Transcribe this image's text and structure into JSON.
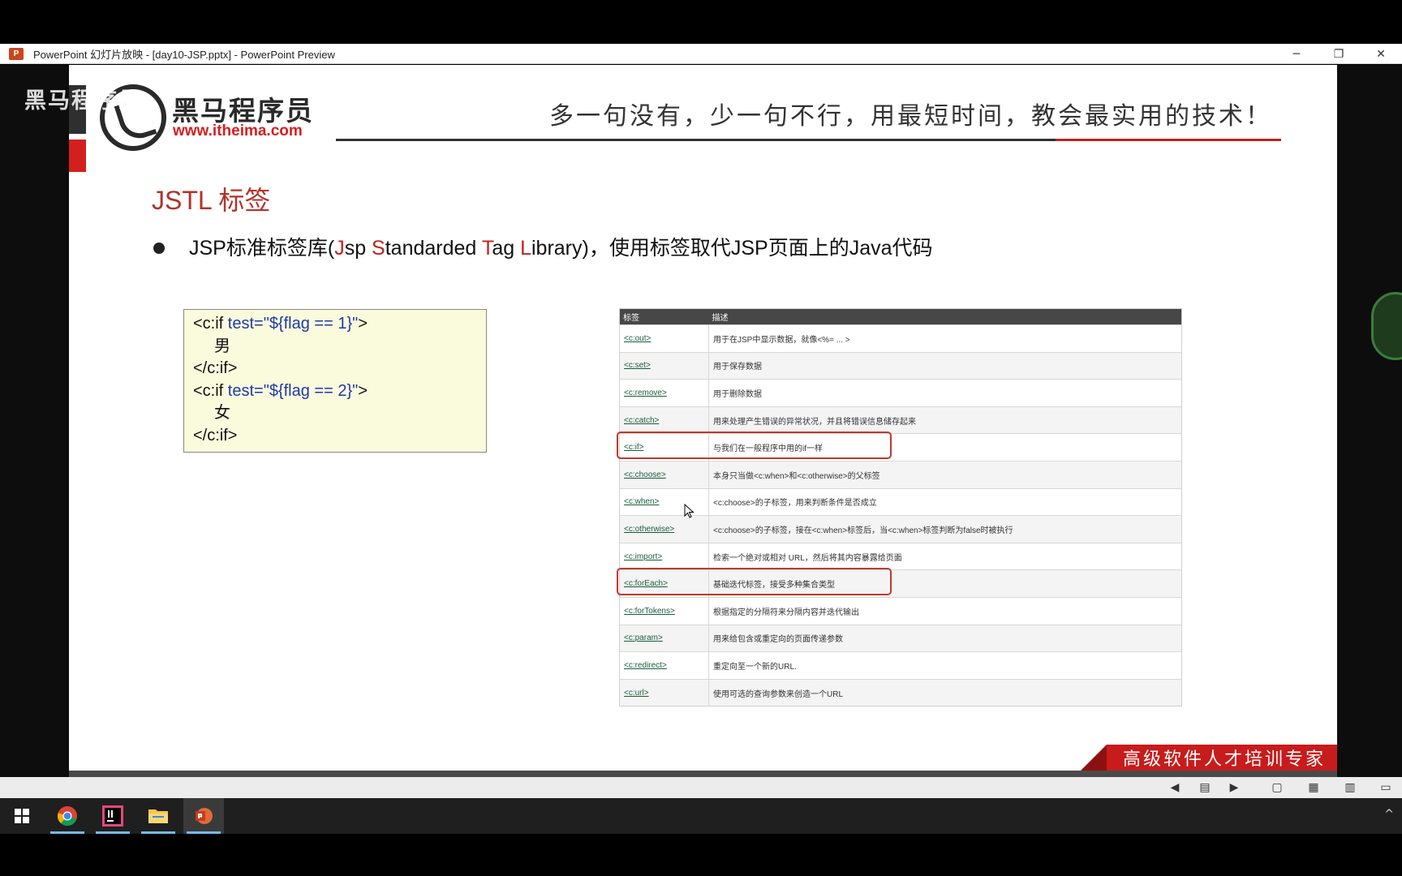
{
  "window": {
    "title": "PowerPoint 幻灯片放映 - [day10-JSP.pptx] - PowerPoint Preview",
    "app_icon_letter": "P",
    "controls": {
      "minimize": "─",
      "restore": "❐",
      "close": "✕"
    }
  },
  "slide": {
    "watermark": "黑马程序员",
    "logo_cn": "黑马程序员",
    "logo_url": "www.itheima.com",
    "slogan": "多一句没有，少一句不行，用最短时间，教会最实用的技术！",
    "title": "JSTL 标签",
    "bullet": {
      "prefix": "JSP标准标签库(",
      "j": "J",
      "sp": "sp ",
      "s": "S",
      "tandarded": "tandarded ",
      "t": "T",
      "ag": "ag ",
      "l": "L",
      "ibrary": "ibrary)，使用标签取代JSP页面上的Java代码"
    },
    "code": {
      "line1_open": "<c:if ",
      "line1_attr": "test=\"${flag == 1}\"",
      "line1_close": ">",
      "line2": "男",
      "line3": "</c:if>",
      "line4_open": "<c:if ",
      "line4_attr": "test=\"${flag == 2}\"",
      "line4_close": ">",
      "line5": "女",
      "line6": "</c:if>"
    },
    "table": {
      "headers": [
        "标签",
        "描述"
      ],
      "rows": [
        {
          "tag": "<c:out>",
          "desc": "用于在JSP中显示数据，就像<%= ... >"
        },
        {
          "tag": "<c:set>",
          "desc": "用于保存数据"
        },
        {
          "tag": "<c:remove>",
          "desc": "用于删除数据"
        },
        {
          "tag": "<c:catch>",
          "desc": "用来处理产生错误的异常状况，并且将错误信息储存起来"
        },
        {
          "tag": "<c:if>",
          "desc": "与我们在一般程序中用的if一样"
        },
        {
          "tag": "<c:choose>",
          "desc": "本身只当做<c:when>和<c:otherwise>的父标签"
        },
        {
          "tag": "<c:when>",
          "desc": "<c:choose>的子标签，用来判断条件是否成立"
        },
        {
          "tag": "<c:otherwise>",
          "desc": "<c:choose>的子标签，接在<c:when>标签后，当<c:when>标签判断为false时被执行"
        },
        {
          "tag": "<c:import>",
          "desc": "检索一个绝对或相对 URL，然后将其内容暴露给页面"
        },
        {
          "tag": "<c:forEach>",
          "desc": "基础迭代标签，接受多种集合类型"
        },
        {
          "tag": "<c:forTokens>",
          "desc": "根据指定的分隔符来分隔内容并迭代输出"
        },
        {
          "tag": "<c:param>",
          "desc": "用来给包含或重定向的页面传递参数"
        },
        {
          "tag": "<c:redirect>",
          "desc": "重定向至一个新的URL."
        },
        {
          "tag": "<c:url>",
          "desc": "使用可选的查询参数来创造一个URL"
        }
      ]
    },
    "footer_banner": "高级软件人才培训专家"
  },
  "statusbar": {
    "prev_icon": "◀",
    "notes_icon": "▤",
    "next_icon": "▶",
    "normal_view_icon": "▢",
    "sorter_view_icon": "▦",
    "reading_view_icon": "▥",
    "slideshow_icon": "▭"
  },
  "taskbar": {
    "chevron": "^"
  },
  "colors": {
    "accent_red": "#c0231f",
    "code_keyword_blue": "#1f3aa8",
    "table_header": "#474747",
    "tag_link_green": "#1a5e3a"
  }
}
